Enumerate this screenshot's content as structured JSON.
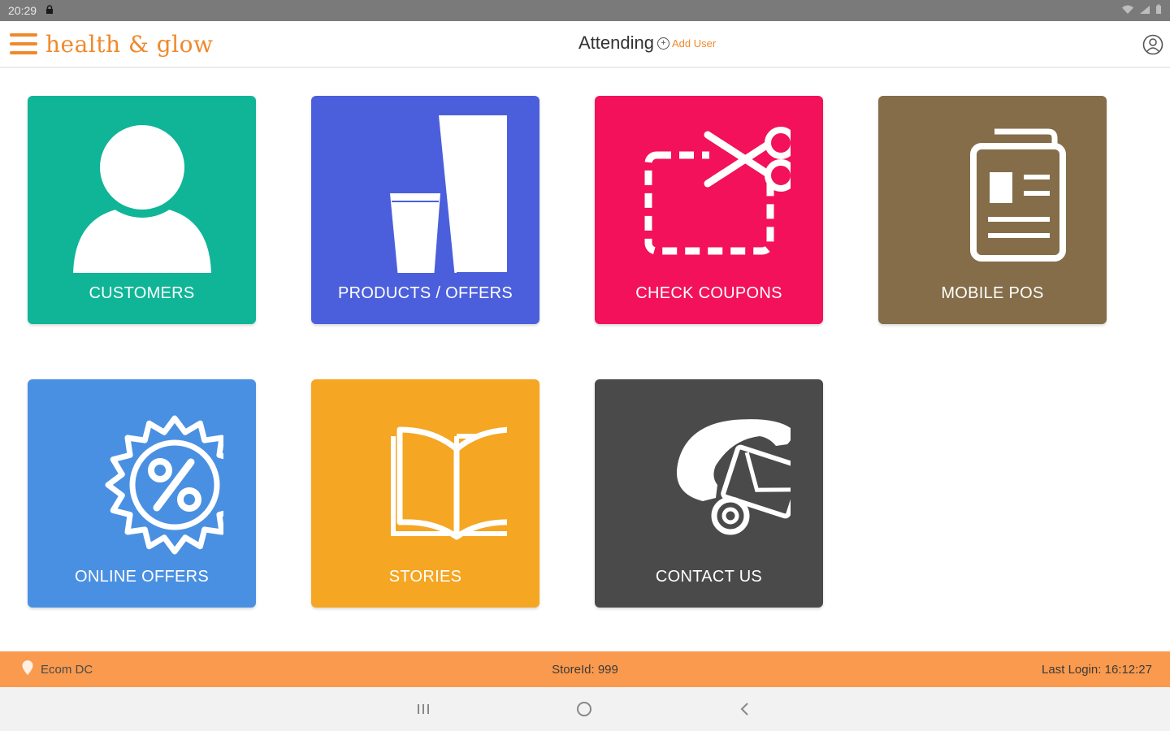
{
  "status_bar": {
    "time": "20:29"
  },
  "app_bar": {
    "brand": "health & glow",
    "attending_label": "Attending",
    "add_user_label": "Add User"
  },
  "tiles": [
    {
      "label": "CUSTOMERS",
      "color": "#0fb596",
      "icon": "customer-icon"
    },
    {
      "label": "PRODUCTS / OFFERS",
      "color": "#4b5fdc",
      "icon": "products-icon"
    },
    {
      "label": "CHECK COUPONS",
      "color": "#f2115a",
      "icon": "coupon-scissors-icon"
    },
    {
      "label": "MOBILE POS",
      "color": "#846d48",
      "icon": "mobile-pos-icon"
    },
    {
      "label": "ONLINE OFFERS",
      "color": "#4a90e2",
      "icon": "discount-badge-icon"
    },
    {
      "label": "STORIES",
      "color": "#f5a623",
      "icon": "open-book-icon"
    },
    {
      "label": "CONTACT US",
      "color": "#4a4a4a",
      "icon": "contact-phone-mail-icon"
    }
  ],
  "footer": {
    "location": "Ecom DC",
    "store_id": "StoreId: 999",
    "last_login": "Last Login: 16:12:27",
    "color": "#fa9a4e"
  },
  "brand_color": "#f0892b"
}
